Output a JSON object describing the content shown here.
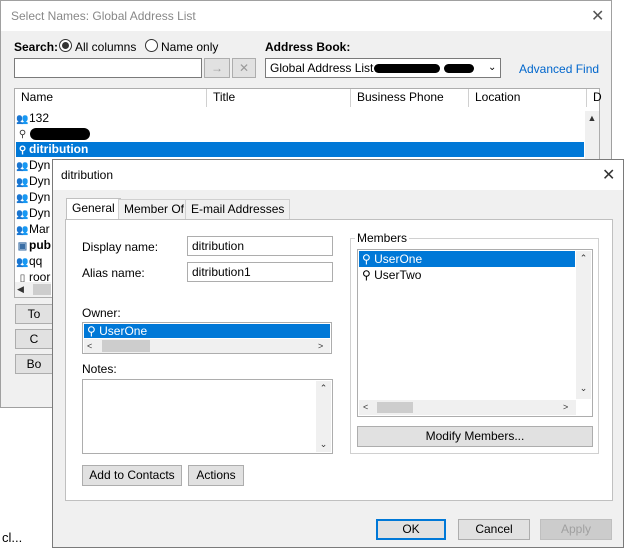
{
  "background_window": {
    "title": "Select Names: Global Address List",
    "search_label": "Search:",
    "radio_all_columns": "All columns",
    "radio_name_only": "Name only",
    "search_value": "",
    "address_book_label": "Address Book:",
    "address_book_value": "Global Address List - ",
    "advanced_find": "Advanced Find",
    "columns": [
      "Name",
      "Title",
      "Business Phone",
      "Location",
      "D"
    ],
    "rows": [
      "132",
      "",
      "ditribution",
      "Dyn",
      "Dyn",
      "Dyn",
      "Dyn",
      "Mar",
      "pub",
      "qq",
      "roor"
    ],
    "side_buttons": [
      "To",
      "C",
      "Bo"
    ],
    "bottom_text": "cl..."
  },
  "dialog": {
    "title": "ditribution",
    "tabs": [
      "General",
      "Member Of",
      "E-mail Addresses"
    ],
    "display_name_label": "Display name:",
    "display_name_value": "ditribution",
    "alias_name_label": "Alias name:",
    "alias_name_value": "ditribution1",
    "owner_label": "Owner:",
    "owner_value": "UserOne",
    "notes_label": "Notes:",
    "notes_value": "",
    "members_label": "Members",
    "members": [
      "UserOne",
      "UserTwo"
    ],
    "modify_members": "Modify Members...",
    "add_to_contacts": "Add to Contacts",
    "actions": "Actions",
    "ok": "OK",
    "cancel": "Cancel",
    "apply": "Apply"
  }
}
